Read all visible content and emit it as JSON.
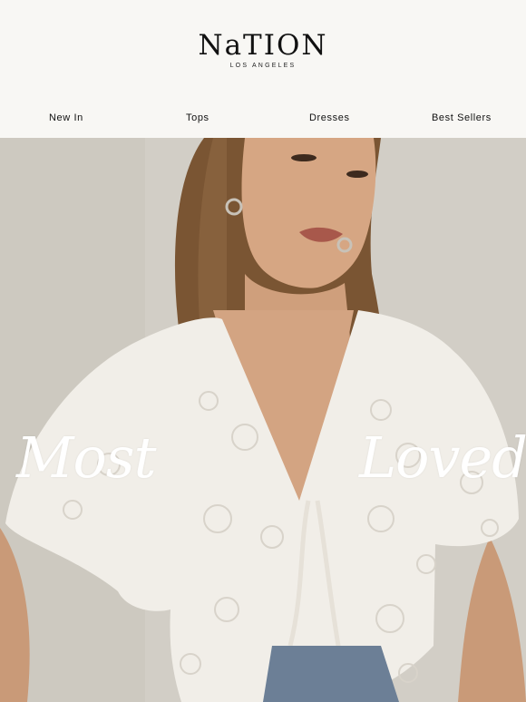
{
  "brand": {
    "name": "NaTION",
    "tagline": "LOS ANGELES"
  },
  "nav": {
    "items": [
      "New In",
      "Tops",
      "Dresses",
      "Best Sellers"
    ]
  },
  "hero": {
    "title_left": "Most",
    "title_right": "Loved"
  },
  "colors": {
    "background": "#f8f7f4",
    "text": "#111111",
    "hero_text": "#ffffff"
  }
}
